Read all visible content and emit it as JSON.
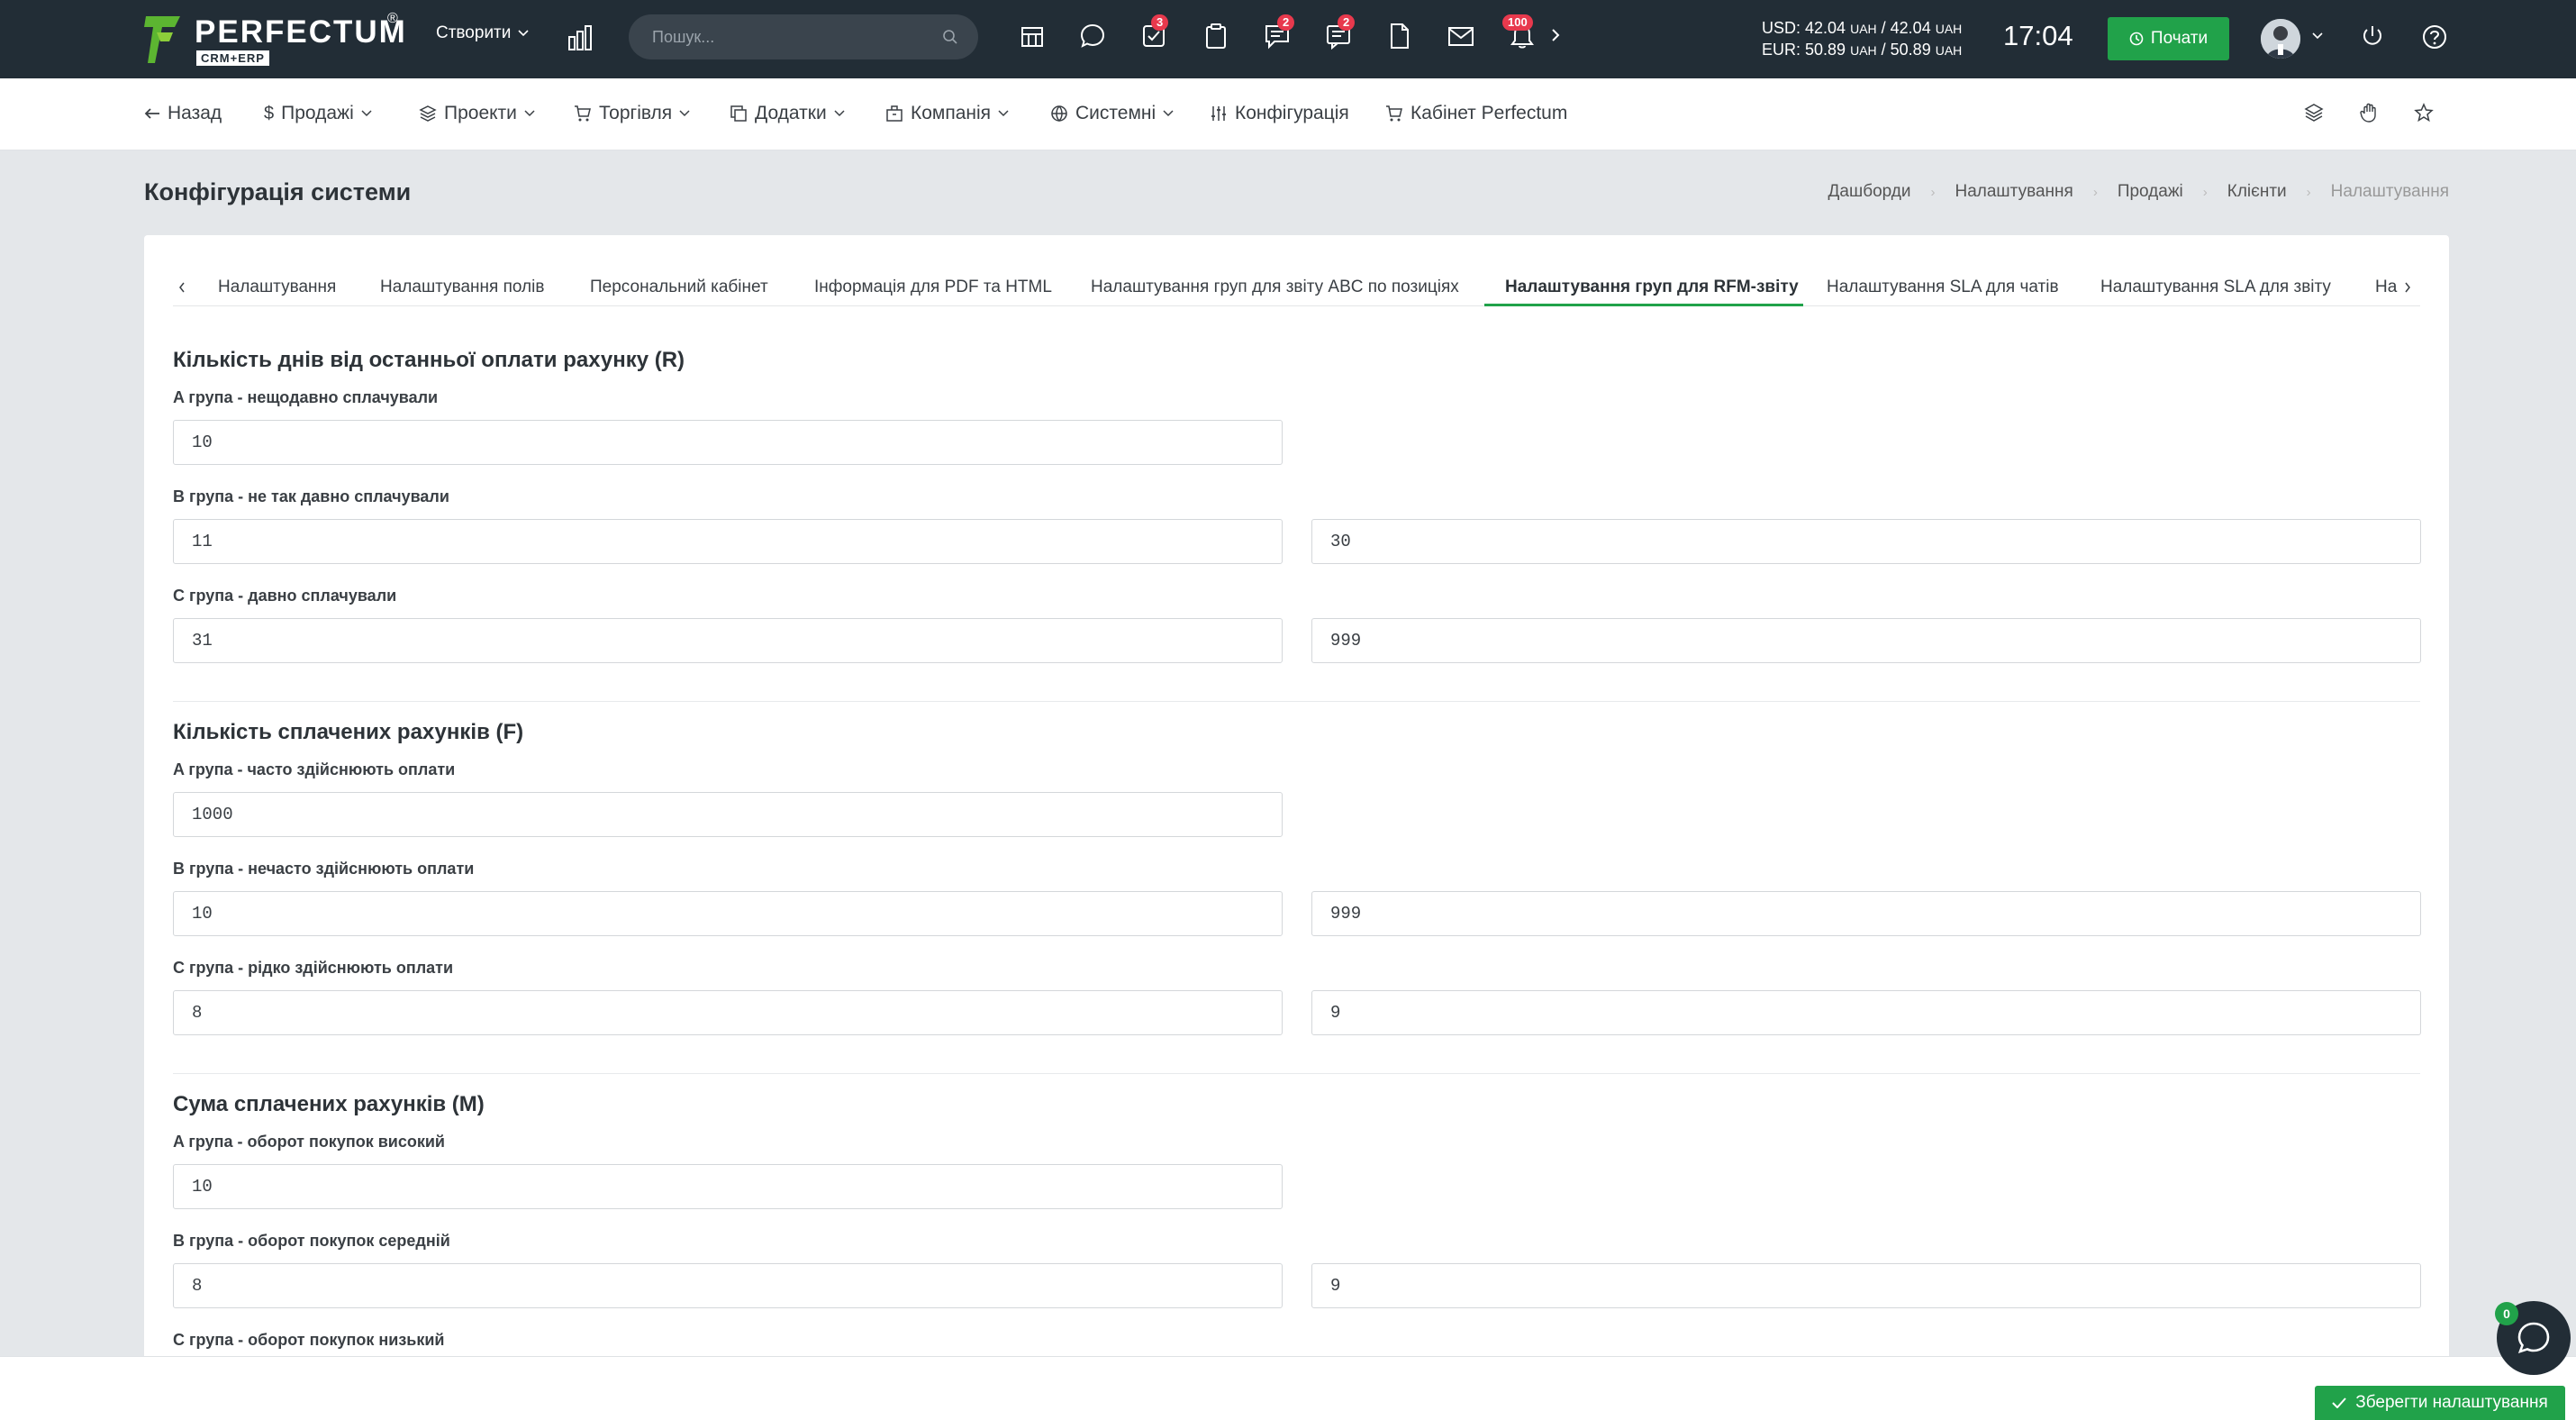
{
  "topbar": {
    "logo_text": "PERFECTUM",
    "logo_sub": "CRM+ERP",
    "logo_reg": "®",
    "create_label": "Створити",
    "search_placeholder": "Пошук...",
    "badges": {
      "tasks": "3",
      "comments": "2",
      "chat": "2",
      "notifications": "100"
    },
    "currency_usd": "USD: 42.04",
    "currency_usd_unit": "UAH",
    "currency_usd_sep": "/ 42.04",
    "currency_usd_unit2": "UAH",
    "currency_eur": "EUR: 50.89",
    "currency_eur_unit": "UAH",
    "currency_eur_sep": "/ 50.89",
    "currency_eur_unit2": "UAH",
    "clock": "17:04",
    "start_label": "Почати"
  },
  "nav": {
    "back": "Назад",
    "items": [
      "Продажі",
      "Проекти",
      "Торгівля",
      "Додатки",
      "Компанія",
      "Системні",
      "Конфігурація",
      "Кабінет Perfectum"
    ]
  },
  "page": {
    "title": "Конфігурація системи",
    "breadcrumb": [
      "Дашборди",
      "Налаштування",
      "Продажі",
      "Клієнти",
      "Налаштування"
    ]
  },
  "tabs": {
    "items": [
      "Налаштування",
      "Налаштування полів",
      "Персональний кабінет",
      "Інформація для PDF та HTML",
      "Налаштування груп для звіту ABC по позиціях",
      "Налаштування груп для RFM-звіту",
      "Налаштування SLA для чатів",
      "Налаштування SLA для звіту",
      "На"
    ],
    "active_index": 5
  },
  "sections": [
    {
      "title": "Кількість днів від останньої оплати рахунку (R)",
      "groups": [
        {
          "label": "A група - нещодавно сплачували",
          "from": "10",
          "to": null
        },
        {
          "label": "B група - не так давно сплачували",
          "from": "11",
          "to": "30"
        },
        {
          "label": "C група - давно сплачували",
          "from": "31",
          "to": "999"
        }
      ]
    },
    {
      "title": "Кількість сплачених рахунків (F)",
      "groups": [
        {
          "label": "A група - часто здійснюють оплати",
          "from": "1000",
          "to": null
        },
        {
          "label": "B група - нечасто здійснюють оплати",
          "from": "10",
          "to": "999"
        },
        {
          "label": "C група - рідко здійснюють оплати",
          "from": "8",
          "to": "9"
        }
      ]
    },
    {
      "title": "Сума сплачених рахунків (M)",
      "groups": [
        {
          "label": "A група - оборот покупок високий",
          "from": "10",
          "to": null
        },
        {
          "label": "B група - оборот покупок середній",
          "from": "8",
          "to": "9"
        },
        {
          "label": "C група - оборот покупок низький",
          "from": null,
          "to": null
        }
      ]
    }
  ],
  "footer": {
    "save_label": "Зберегти налаштування",
    "chat_badge": "0"
  },
  "colors": {
    "topbar_bg": "#222d36",
    "accent_green": "#21a24a",
    "badge_red": "#e8394d",
    "page_bg": "#e4e7ea"
  }
}
